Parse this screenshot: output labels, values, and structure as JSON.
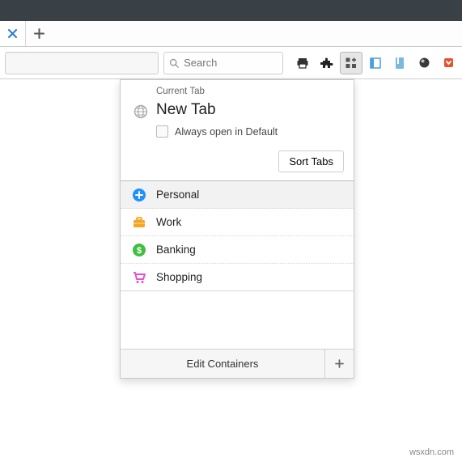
{
  "window": {
    "title": ""
  },
  "tabs": {
    "close_icon": "×",
    "newtab_icon": "+"
  },
  "toolbar": {
    "search_placeholder": "Search",
    "icons": [
      "print",
      "puzzle",
      "containers",
      "sidebar",
      "bookmarks",
      "globe-dark",
      "pocket"
    ]
  },
  "popup": {
    "header_label": "Current Tab",
    "tab_name": "New Tab",
    "always_open_label": "Always open in Default",
    "sort_label": "Sort Tabs",
    "containers": [
      {
        "name": "Personal",
        "icon": "circle-plus",
        "color": "#1e90ff"
      },
      {
        "name": "Work",
        "icon": "briefcase",
        "color": "#f5a623"
      },
      {
        "name": "Banking",
        "icon": "dollar",
        "color": "#3fbf3f"
      },
      {
        "name": "Shopping",
        "icon": "cart",
        "color": "#e84fd1"
      }
    ],
    "footer": {
      "edit_label": "Edit Containers",
      "add_icon": "+"
    }
  },
  "watermark": "wsxdn.com"
}
